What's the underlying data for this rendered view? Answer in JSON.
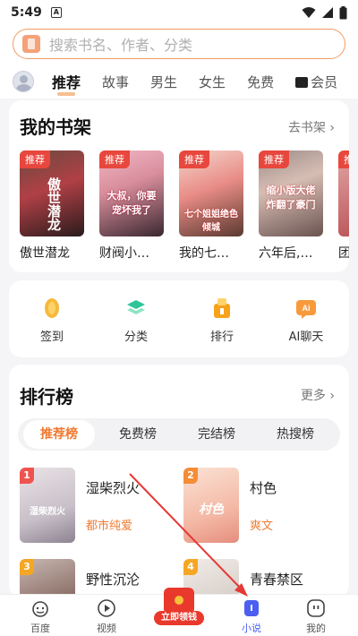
{
  "status": {
    "time": "5:49",
    "notif": "A"
  },
  "search": {
    "placeholder": "搜索书名、作者、分类"
  },
  "tabs": [
    {
      "label": "推荐"
    },
    {
      "label": "故事"
    },
    {
      "label": "男生"
    },
    {
      "label": "女生"
    },
    {
      "label": "免费"
    },
    {
      "label": "会员"
    }
  ],
  "shelf": {
    "title": "我的书架",
    "more": "去书架 ›",
    "books": [
      {
        "tag": "推荐",
        "cover_text": "傲世潜龙",
        "title": "傲世潜龙"
      },
      {
        "tag": "推荐",
        "cover_text": "大叔，你要宠坏我了",
        "title": "财阀小…"
      },
      {
        "tag": "推荐",
        "cover_text": "七个姐姐绝色倾城",
        "title": "我的七…"
      },
      {
        "tag": "推荐",
        "cover_text": "缩小版大佬炸翻了豪门",
        "title": "六年后,…"
      },
      {
        "tag": "推荐",
        "cover_text": "",
        "title": "团"
      }
    ]
  },
  "quick": [
    {
      "label": "签到",
      "icon": "coin-icon"
    },
    {
      "label": "分类",
      "icon": "layers-icon"
    },
    {
      "label": "排行",
      "icon": "trophy-icon"
    },
    {
      "label": "AI聊天",
      "icon": "ai-chat-icon"
    }
  ],
  "rank": {
    "title": "排行榜",
    "more": "更多 ›",
    "pills": [
      "推荐榜",
      "免费榜",
      "完结榜",
      "热搜榜"
    ],
    "items": [
      {
        "num": "1",
        "title": "湿柴烈火",
        "sub": "都市纯爱",
        "cover_text": "湿柴烈火"
      },
      {
        "num": "2",
        "title": "村色",
        "sub": "爽文",
        "cover_text": "村色"
      },
      {
        "num": "3",
        "title": "野性沉沦",
        "sub": "",
        "cover_text": ""
      },
      {
        "num": "4",
        "title": "青春禁区",
        "sub": "",
        "cover_text": ""
      }
    ]
  },
  "nav": [
    {
      "label": "百度"
    },
    {
      "label": "视频"
    },
    {
      "label": "立即领钱"
    },
    {
      "label": "小说"
    },
    {
      "label": "我的"
    }
  ],
  "colors": {
    "accent": "#f0782f",
    "nav_active": "#4b5ff0",
    "tag": "#e8473d",
    "annotation": "#e53935"
  }
}
